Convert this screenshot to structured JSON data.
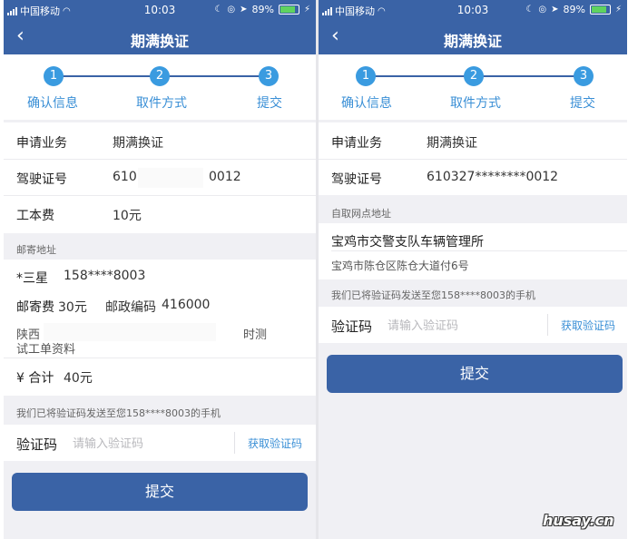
{
  "status_bar": {
    "carrier": "中国移动",
    "time": "10:03",
    "battery": "89%",
    "battery_level": 0.89
  },
  "nav": {
    "title": "期满换证",
    "back_icon": "chevron-left-icon"
  },
  "steps": [
    {
      "number": "1",
      "label": "确认信息"
    },
    {
      "number": "2",
      "label": "取件方式"
    },
    {
      "number": "3",
      "label": "提交"
    }
  ],
  "left": {
    "business_label": "申请业务",
    "business_value": "期满换证",
    "license_label": "驾驶证号",
    "license_value_a": "610",
    "license_value_b": "0012",
    "fee_label": "工本费",
    "fee_value": "10元",
    "mail_section": "邮寄地址",
    "recipient_name": "*三星",
    "recipient_phone": "158****8003",
    "postage_label": "邮寄费",
    "postage_value": "30元",
    "postcode_label": "邮政编码",
    "postcode_value": "416000",
    "address_line1_a": "陕西",
    "address_line1_b": "时测",
    "address_line2": "试工单资料",
    "total_label": "¥ 合计",
    "total_value": "40元",
    "notice": "我们已将验证码发送至您158****8003的手机",
    "code_label": "验证码",
    "code_placeholder": "请输入验证码",
    "get_code": "获取验证码",
    "submit": "提交"
  },
  "right": {
    "business_label": "申请业务",
    "business_value": "期满换证",
    "license_label": "驾驶证号",
    "license_value": "610327********0012",
    "pickup_section": "自取网点地址",
    "pickup_name": "宝鸡市交警支队车辆管理所",
    "pickup_address": "宝鸡市陈仓区陈仓大道付6号",
    "notice": "我们已将验证码发送至您158****8003的手机",
    "code_label": "验证码",
    "code_placeholder": "请输入验证码",
    "get_code": "获取验证码",
    "submit": "提交"
  },
  "watermark": "husay.cn",
  "colors": {
    "primary": "#3a63a6",
    "step_circle": "#3a9be0",
    "link": "#3a8fd6",
    "price_red": "#e5462e",
    "page_bg": "#f0f0f4"
  }
}
